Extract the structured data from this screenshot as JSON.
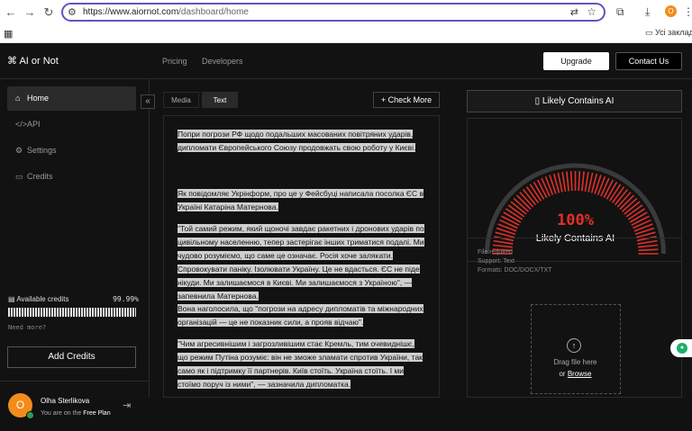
{
  "browser": {
    "url_domain": "https://www.aiornot.com",
    "url_path": "/dashboard/home",
    "profile_initial": "O",
    "bookmarks_folder": "Усі заклад"
  },
  "topbar": {
    "logo": "AI or Not",
    "nav": [
      "Pricing",
      "Developers"
    ],
    "upgrade": "Upgrade",
    "contact": "Contact Us"
  },
  "sidebar": {
    "items": [
      {
        "label": "Home",
        "icon": "home-icon"
      },
      {
        "label": "API",
        "icon": "code-icon"
      },
      {
        "label": "Settings",
        "icon": "gear-icon"
      },
      {
        "label": "Credits",
        "icon": "card-icon"
      }
    ],
    "credits_label": "Available credits",
    "credits_pct": "99.99%",
    "credits_fraction": 0.9999,
    "need_more": "Need more?",
    "add_credits": "Add Credits",
    "user_initial": "O",
    "user_name": "Olha Sterlikova",
    "plan_prefix": "You are on the ",
    "plan_name": "Free Plan"
  },
  "center": {
    "tabs": [
      "Media",
      "Text"
    ],
    "active_tab": "Text",
    "check_more": "Check More",
    "paragraphs": [
      "Попри погрози РФ щодо подальших масованих повітряних ударів, дипломати Європейського Союзу продовжать свою роботу у Києві.",
      "Як повідомляє Укрінформ, про це у Фейсбуці написала посолка ЄС в Україні Катаріна Матернова.",
      "\"Той самий режим, який щоночі завдає ракетних і дронових ударів по цивільному населенню, тепер застерігає інших триматися подалі.   Ми чудово розуміємо, що саме це означає. Росія хоче залякати. Спровокувати паніку. Ізолювати Україну. Це не вдасться. ЄС не піде нікуди.  Ми залишаємося в Києві. Ми залишаємося з Україною\", — запевнила Матернова.",
      "Вона наголосила, що \"погрози на адресу дипломатів та міжнародних організацій — це не показник сили, а прояв відчаю\".",
      "\"Чим агресивнішим і загрозливішим стає Кремль, тим очевиднішє, що режим Путіна розуміє: він не зможе зламати спротив України, так само як і підтримку її партнерів. Київ стоїть. Україна стоїть. І ми стоїмо поруч із ними\", — зазначила дипломатка."
    ]
  },
  "result": {
    "header": "Likely Contains AI",
    "percent": "100%",
    "label": "Likely Contains AI",
    "gauge_fraction": 1.0,
    "accent_color": "#e0302a"
  },
  "upload": {
    "file_required": "File required",
    "support": "Support: Text",
    "formats": "Formats: DOC/DOCX/TXT",
    "drag_text": "Drag file here",
    "or_text": "or ",
    "browse": "Browse"
  }
}
